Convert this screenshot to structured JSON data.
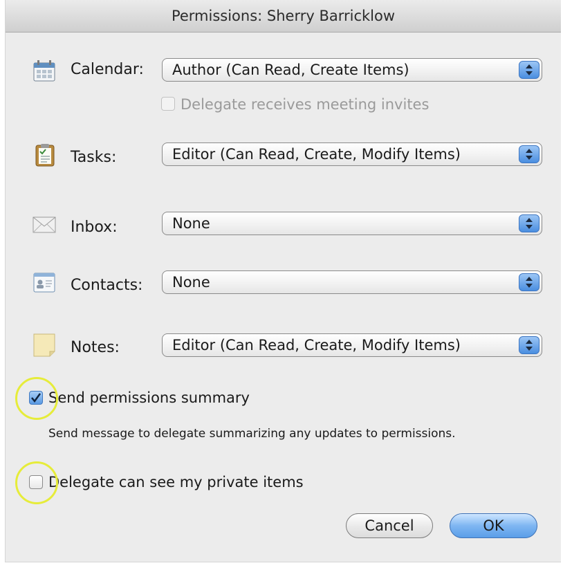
{
  "dialog": {
    "title": "Permissions: Sherry Barricklow"
  },
  "rows": [
    {
      "label": "Calendar:",
      "value": "Author (Can Read, Create Items)",
      "icon": "calendar-icon"
    },
    {
      "label": "Tasks:",
      "value": "Editor (Can Read, Create, Modify Items)",
      "icon": "tasks-icon"
    },
    {
      "label": "Inbox:",
      "value": "None",
      "icon": "envelope-icon"
    },
    {
      "label": "Contacts:",
      "value": "None",
      "icon": "contacts-icon"
    },
    {
      "label": "Notes:",
      "value": "Editor (Can Read, Create, Modify Items)",
      "icon": "notes-icon"
    }
  ],
  "delegate_invites": {
    "label": "Delegate receives meeting invites",
    "checked": false,
    "enabled": false
  },
  "send_summary": {
    "label": "Send permissions summary",
    "checked": true,
    "help": "Send message to delegate summarizing any updates to permissions."
  },
  "private_items": {
    "label": "Delegate can see my private items",
    "checked": false
  },
  "buttons": {
    "cancel": "Cancel",
    "ok": "OK"
  },
  "colors": {
    "highlight": "#e6ec3a",
    "accent": "#5a9ee8"
  }
}
